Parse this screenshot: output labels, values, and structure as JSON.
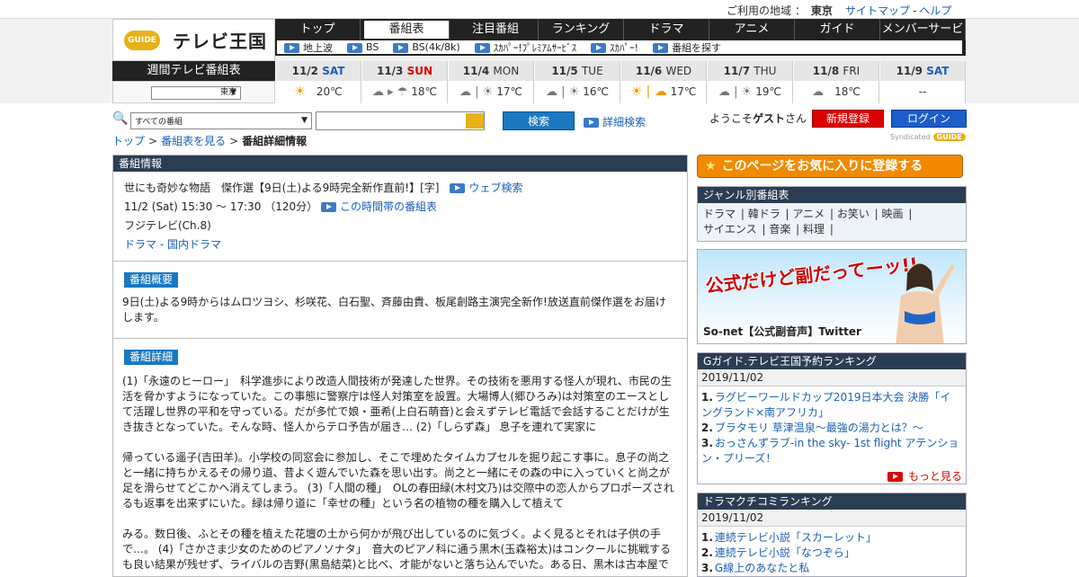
{
  "topbar": {
    "region_label": "ご利用の地域 ：",
    "region_value": "東京",
    "links": [
      "サイトマップ",
      "ヘルプ"
    ],
    "link_sep": "-"
  },
  "logo": {
    "badge": "GUIDE",
    "text": "テレビ王国"
  },
  "main_nav": [
    "トップ",
    "番組表",
    "注目番組",
    "ランキング",
    "ドラマ",
    "アニメ",
    "ガイド",
    "メンバーサービス"
  ],
  "sub_nav": [
    "地上波",
    "BS",
    "BS(4k/8k)",
    "ｽｶﾊﾟｰ!ﾌﾟﾚﾐｱﾑｻｰﾋﾞｽ",
    "ｽｶﾊﾟｰ!",
    "番組を探す"
  ],
  "week": {
    "title": "週間テレビ番組表",
    "area": "東京",
    "days": [
      {
        "date": "11/2",
        "wd": "SAT",
        "kind": "sat",
        "weather": "☀",
        "temp": "20℃"
      },
      {
        "date": "11/3",
        "wd": "SUN",
        "kind": "sun",
        "weather": "☁ ▸ ☂",
        "temp": "18℃"
      },
      {
        "date": "11/4",
        "wd": "MON",
        "kind": "",
        "weather": "☁ | ☀",
        "temp": "17℃"
      },
      {
        "date": "11/5",
        "wd": "TUE",
        "kind": "",
        "weather": "☁ | ☀",
        "temp": "16℃"
      },
      {
        "date": "11/6",
        "wd": "WED",
        "kind": "",
        "weather": "☀ | ☁",
        "temp": "17℃"
      },
      {
        "date": "11/7",
        "wd": "THU",
        "kind": "",
        "weather": "☁ | ☀",
        "temp": "19℃"
      },
      {
        "date": "11/8",
        "wd": "FRI",
        "kind": "",
        "weather": "☁",
        "temp": "18℃"
      },
      {
        "date": "11/9",
        "wd": "SAT",
        "kind": "sat",
        "weather": "",
        "temp": "--"
      }
    ]
  },
  "search": {
    "category": "すべての番組",
    "query": "",
    "button": "検索",
    "advanced": "詳細検索"
  },
  "user": {
    "welcome_pre": "ようこそ",
    "welcome_name": "ゲスト",
    "welcome_post": "さん",
    "register": "新規登録",
    "login": "ログイン"
  },
  "breadcrumb": {
    "items": [
      "トップ",
      "番組表を見る"
    ],
    "current": "番組詳細情報",
    "sep": ">"
  },
  "syndicated": {
    "label": "Syndicated",
    "badge": "GUIDE"
  },
  "program": {
    "section": "番組情報",
    "title": "世にも奇妙な物語　傑作選【9日(土)よる9時完全新作直前!】[字]",
    "web_search": "ウェブ検索",
    "time": "11/2 (Sat) 15:30 ～ 17:30 （120分）",
    "time_link": "この時間帯の番組表",
    "channel": "フジテレビ(Ch.8)",
    "genre1": "ドラマ",
    "genre_sep": " - ",
    "genre2": "国内ドラマ",
    "summary_label": "番組概要",
    "summary": "9日(土)よる9時からはムロツヨシ、杉咲花、白石聖、斉藤由貴、板尾創路主演完全新作!放送直前傑作選をお届けします。",
    "detail_label": "番組詳細",
    "detail": [
      "(1)「永遠のヒーロー」　科学進歩により改造人間技術が発達した世界。その技術を悪用する怪人が現れ、市民の生活を脅かすようになっていた。この事態に警察庁は怪人対策室を設置。大場博人(郷ひろみ)は対策室のエースとして活躍し世界の平和を守っている。だが多忙で娘・亜希(上白石萌音)と会えずテレビ電話で会話することだけが生き抜きとなっていた。そんな時、怪人からテロ予告が届き… (2)「しらず森」 息子を連れて実家に",
      "帰っている遥子(吉田羊)。小学校の同窓会に参加し、そこで埋めたタイムカプセルを掘り起こす事に。息子の尚之と一緒に持ちかえるその帰り道、昔よく遊んでいた森を思い出す。尚之と一緒にその森の中に入っていくと尚之が足を滑らせてどこかへ消えてしまう。 (3)「人間の種」　OLの春田緑(木村文乃)は交際中の恋人からプロポーズされるも返事を出来ずにいた。緑は帰り道に「幸せの種」という名の植物の種を購入して植えて",
      "みる。数日後、ふとその種を植えた花壇の土から何かが飛び出しているのに気づく。よく見るとそれは子供の手で…。 (4)「さかさま少女のためのピアノソナタ」　音大のピアノ科に通う黒木(玉森裕太)はコンクールに挑戦するも良い結果が残せず、ライバルの吉野(黒島結菜)と比べ、才能がないと落ち込んでいた。ある日、黒木は古本屋で"
    ]
  },
  "sidebar": {
    "favorite": "このページをお気に入りに登録する",
    "genre_title": "ジャンル別番組表",
    "genres": [
      "ドラマ",
      "韓ドラ",
      "アニメ",
      "お笑い",
      "映画",
      "サイエンス",
      "音楽",
      "料理"
    ],
    "banner": {
      "headline": "公式だけど副だってーッ!!",
      "caption": "So-net【公式副音声】Twitter"
    },
    "ranking1": {
      "title": "Gガイド.テレビ王国予約ランキング",
      "date": "2019/11/02",
      "items": [
        "ラグビーワールドカップ2019日本大会 決勝「イングランド×南アフリカ」",
        "ブラタモリ 草津温泉〜最強の湯力とは？〜",
        "おっさんずラブ-in the sky- 1st flight アテンション・プリーズ！"
      ],
      "more": "もっと見る"
    },
    "ranking2": {
      "title": "ドラマクチコミランキング",
      "date": "2019/11/02",
      "items": [
        "連続テレビ小説「スカーレット」",
        "連続テレビ小説「なつぞら」",
        "G線上のあなたと私"
      ]
    }
  },
  "colors": {
    "nav_bg": "#222222",
    "accent_blue": "#1b78c0",
    "header_navy": "#2b3d52",
    "favorite_orange": "#f28a00",
    "register_red": "#dd0000"
  }
}
